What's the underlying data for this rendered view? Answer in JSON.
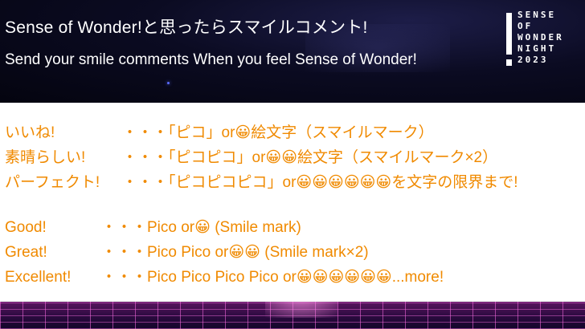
{
  "header": {
    "title_jp": "Sense of Wonder!と思ったらスマイルコメント!",
    "title_en": "Send your smile comments When you feel Sense of Wonder!",
    "logo_lines": [
      "SENSE",
      "OF",
      "WONDER",
      "NIGHT",
      "2023"
    ]
  },
  "rows_jp": [
    {
      "label": "いいね!",
      "text": "・・・「ピコ」or😀絵文字（スマイルマーク）"
    },
    {
      "label": "素晴らしい!",
      "text": "・・・「ピコピコ」or😀😀絵文字（スマイルマーク×2）"
    },
    {
      "label": "パーフェクト!",
      "text": "・・・「ピコピコピコ」or😀😀😀😀😀😀を文字の限界まで!"
    }
  ],
  "rows_en": [
    {
      "label": "Good!",
      "text": "・・・Pico or😀 (Smile mark)"
    },
    {
      "label": "Great!",
      "text": "・・・Pico Pico or😀😀 (Smile mark×2)"
    },
    {
      "label": "Excellent!",
      "text": "・・・Pico Pico Pico Pico or😀😀😀😀😀😀...more!"
    }
  ],
  "colors": {
    "accent_text": "#f08a00",
    "banner_bg": "#080818",
    "title_text": "#ffffff",
    "floor_grid": "#ff6ee6"
  },
  "icons": [
    "smile-emoji",
    "sense-of-wonder-logo-icon"
  ]
}
